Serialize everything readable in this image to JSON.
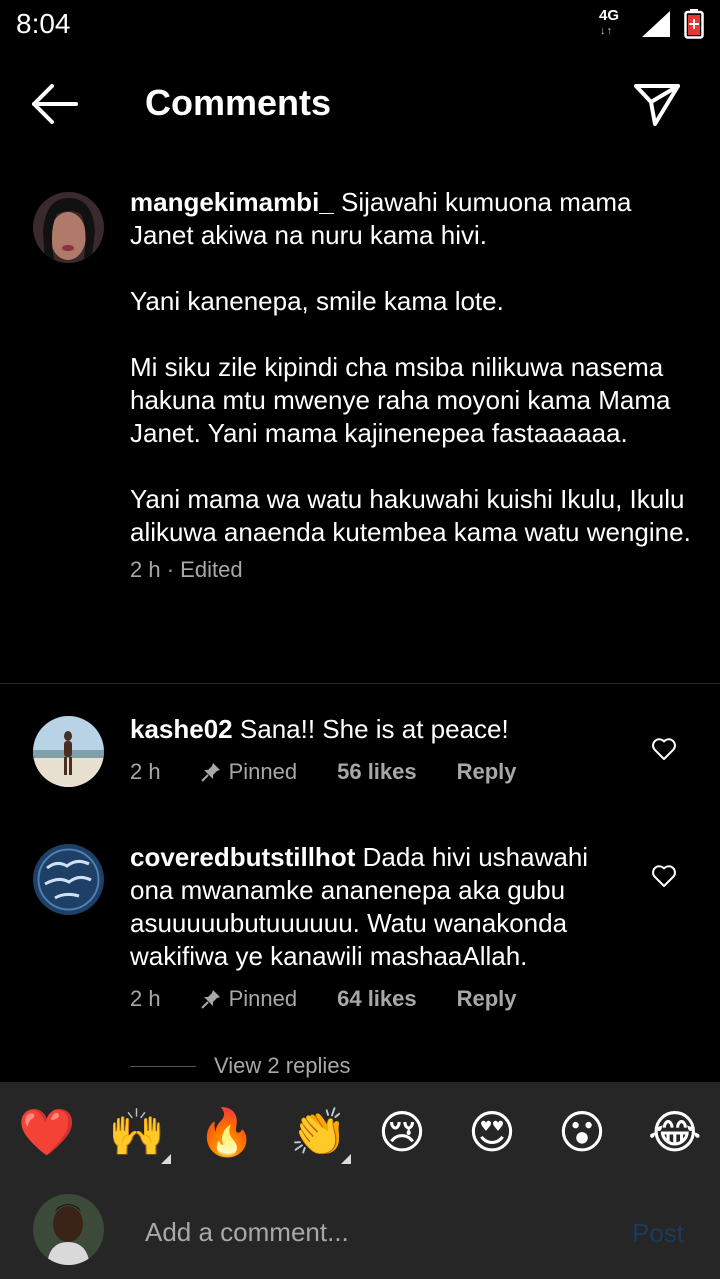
{
  "status": {
    "time": "8:04",
    "network": "4G"
  },
  "header": {
    "title": "Comments"
  },
  "caption": {
    "username": "mangekimambi_",
    "paragraphs": [
      "Sijawahi kumuona mama Janet akiwa na nuru kama hivi.",
      "Yani kanenepa, smile kama lote.",
      "Mi siku zile kipindi cha msiba nilikuwa nasema hakuna mtu mwenye raha moyoni kama Mama Janet. Yani mama kajinenepea fastaaaaaa.",
      "Yani mama wa watu hakuwahi kuishi Ikulu, Ikulu alikuwa anaenda kutembea kama watu wengine."
    ],
    "time": "2 h",
    "separator": "·",
    "edited": "Edited"
  },
  "comments": [
    {
      "username": "kashe02",
      "text": "Sana!! She is at peace!",
      "time": "2 h",
      "pinned": "Pinned",
      "likes": "56 likes",
      "reply": "Reply"
    },
    {
      "username": "coveredbutstillhot",
      "text": "Dada hivi ushawahi ona mwanamke  ananenepa aka gubu asuuuuubutuuuuuu. Watu wanakonda wakifiwa ye kanawili mashaaAllah.",
      "time": "2 h",
      "pinned": "Pinned",
      "likes": "64 likes",
      "reply": "Reply"
    }
  ],
  "view_replies": "View 2 replies",
  "reactions": [
    "❤️",
    "🙌",
    "🔥",
    "👏",
    "😢",
    "😍",
    "😮",
    "😂"
  ],
  "composer": {
    "placeholder": "Add a comment...",
    "post_label": "Post"
  },
  "colors": {
    "background": "#000000",
    "panel": "#262626",
    "muted_text": "#a8a8a8",
    "post_disabled": "#1b3a5c",
    "battery": "#e53935"
  },
  "icons": [
    "back-arrow-icon",
    "send-icon",
    "heart-icon",
    "pin-icon",
    "signal-icon",
    "battery-icon"
  ]
}
